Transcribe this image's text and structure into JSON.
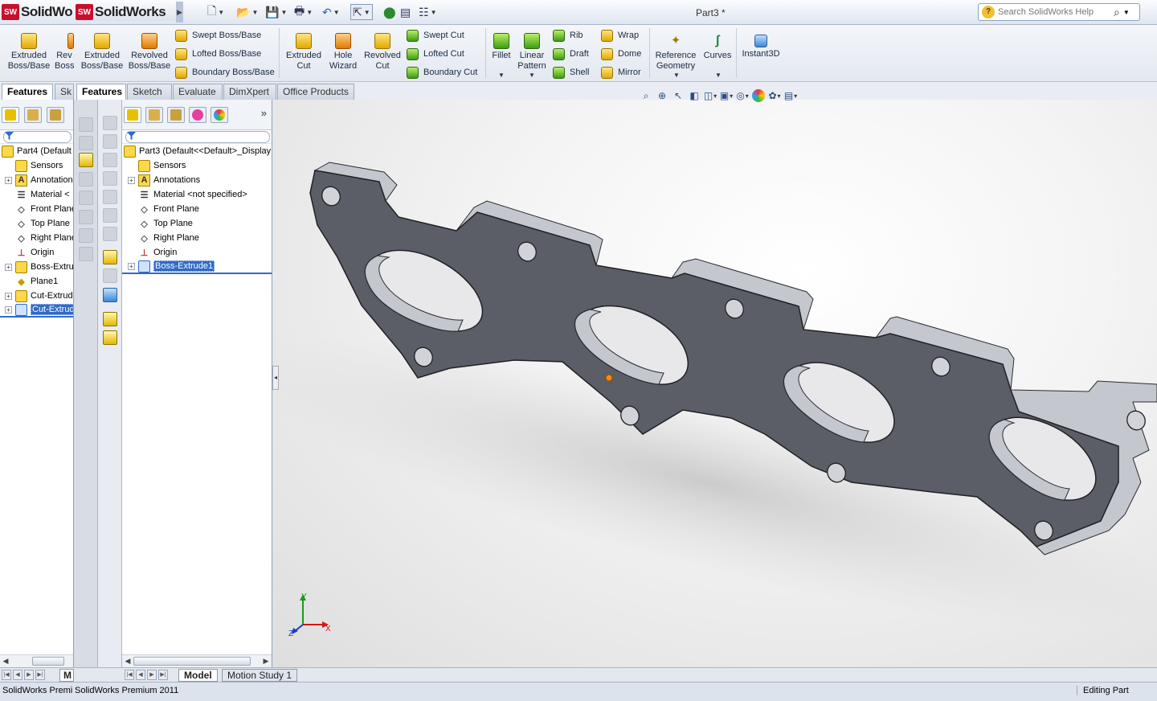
{
  "app": {
    "brand_a": "SolidWo",
    "brand_b": "SolidWorks",
    "doc_title": "Part3 *"
  },
  "search": {
    "placeholder": "Search SolidWorks Help"
  },
  "command_manager": {
    "extruded_boss_a": "Extruded\nBoss/Base",
    "rev_truncated": "Rev\nBoss",
    "extruded_boss_b": "Extruded\nBoss/Base",
    "revolved_boss": "Revolved\nBoss/Base",
    "swept_boss": "Swept Boss/Base",
    "lofted_boss": "Lofted Boss/Base",
    "boundary_boss": "Boundary Boss/Base",
    "extruded_cut": "Extruded\nCut",
    "hole_wizard": "Hole\nWizard",
    "revolved_cut": "Revolved\nCut",
    "swept_cut": "Swept Cut",
    "lofted_cut": "Lofted Cut",
    "boundary_cut": "Boundary Cut",
    "fillet": "Fillet",
    "linear_pattern": "Linear\nPattern",
    "rib": "Rib",
    "draft": "Draft",
    "shell": "Shell",
    "wrap": "Wrap",
    "dome": "Dome",
    "mirror": "Mirror",
    "reference_geometry": "Reference\nGeometry",
    "curves": "Curves",
    "instant3d": "Instant3D"
  },
  "tabs_left": {
    "features": "Features",
    "sketch_trunc": "Sk"
  },
  "tabs": [
    "Features",
    "Sketch",
    "Evaluate",
    "DimXpert",
    "Office Products"
  ],
  "tree_a": {
    "root": "Part4  (Default",
    "items": [
      "Sensors",
      "Annotations",
      "Material <",
      "Front Plane",
      "Top Plane",
      "Right Plane",
      "Origin",
      "Boss-Extrude",
      "Plane1",
      "Cut-Extrude",
      "Cut-Extrude"
    ]
  },
  "tree_b": {
    "root": "Part3  (Default<<Default>_Display",
    "items": [
      "Sensors",
      "Annotations",
      "Material <not specified>",
      "Front Plane",
      "Top Plane",
      "Right Plane",
      "Origin",
      "Boss-Extrude1"
    ]
  },
  "triad": {
    "x": "X",
    "y": "Y",
    "z": "Z"
  },
  "bottom_tabs": {
    "model_trunc": "M",
    "model": "Model",
    "motion_study": "Motion Study 1"
  },
  "status": {
    "left_a": "SolidWorks Premiu",
    "left_b": "SolidWorks Premium 2011",
    "right": "Editing Part"
  },
  "colors": {
    "part_face": "#5b5e66",
    "part_side": "#c6c8d0",
    "selection": "#316ac5",
    "accent_orange": "#ff8c00"
  }
}
